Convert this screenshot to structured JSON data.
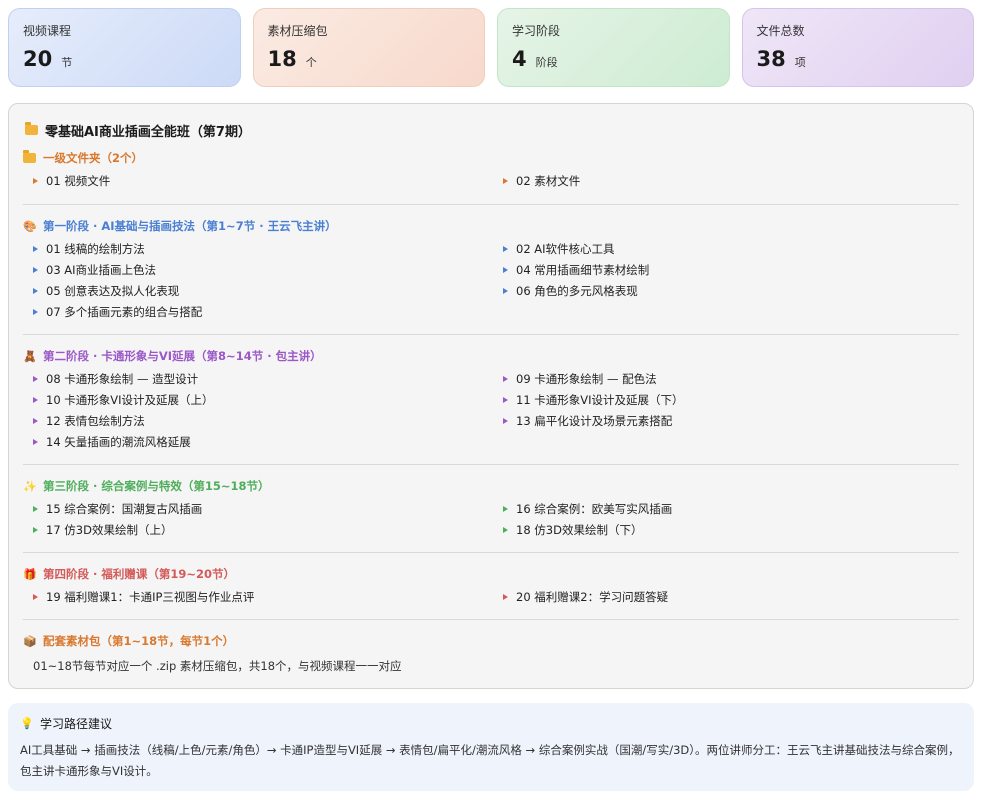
{
  "stats": [
    {
      "label": "视频课程",
      "value": "20",
      "unit": "节"
    },
    {
      "label": "素材压缩包",
      "value": "18",
      "unit": "个"
    },
    {
      "label": "学习阶段",
      "value": "4",
      "unit": "阶段"
    },
    {
      "label": "文件总数",
      "value": "38",
      "unit": "项"
    }
  ],
  "tree": {
    "title": "零基础AI商业插画全能班（第7期）",
    "sections": [
      {
        "title": "一级文件夹（2个）",
        "color": "#d9782f",
        "icon": "folder-icon",
        "items": [
          "01 视频文件",
          "02 素材文件"
        ]
      },
      {
        "title": "第一阶段 · AI基础与插画技法（第1~7节 · 王云飞主讲）",
        "color": "#4a7fd1",
        "icon": "palette-icon",
        "items": [
          "01 线稿的绘制方法",
          "02 AI软件核心工具",
          "03 AI商业插画上色法",
          "04 常用插画细节素材绘制",
          "05 创意表达及拟人化表现",
          "06 角色的多元风格表现",
          "07 多个插画元素的组合与搭配"
        ]
      },
      {
        "title": "第二阶段 · 卡通形象与VI延展（第8~14节 · 包主讲）",
        "color": "#9b59c7",
        "icon": "bear-icon",
        "items": [
          "08 卡通形象绘制 — 造型设计",
          "09 卡通形象绘制 — 配色法",
          "10 卡通形象VI设计及延展（上）",
          "11 卡通形象VI设计及延展（下）",
          "12 表情包绘制方法",
          "13 扁平化设计及场景元素搭配",
          "14 矢量插画的潮流风格延展"
        ]
      },
      {
        "title": "第三阶段 · 综合案例与特效（第15~18节）",
        "color": "#4fae5c",
        "icon": "sparkle-icon",
        "items": [
          "15 综合案例：国潮复古风插画",
          "16 综合案例：欧美写实风插画",
          "17 仿3D效果绘制（上）",
          "18 仿3D效果绘制（下）"
        ]
      },
      {
        "title": "第四阶段 · 福利赠课（第19~20节）",
        "color": "#d45a5a",
        "icon": "gift-icon",
        "items": [
          "19 福利赠课1：卡通IP三视图与作业点评",
          "20 福利赠课2：学习问题答疑"
        ]
      },
      {
        "title": "配套素材包（第1~18节，每节1个）",
        "color": "#d9782f",
        "icon": "package-icon",
        "note": "01~18节每节对应一个 .zip 素材压缩包，共18个，与视频课程一一对应"
      }
    ]
  },
  "tip": {
    "title": "学习路径建议",
    "body": "AI工具基础 → 插画技法（线稿/上色/元素/角色）→ 卡通IP造型与VI延展 → 表情包/扁平化/潮流风格 → 综合案例实战（国潮/写实/3D）。两位讲师分工：王云飞主讲基础技法与综合案例，包主讲卡通形象与VI设计。"
  }
}
